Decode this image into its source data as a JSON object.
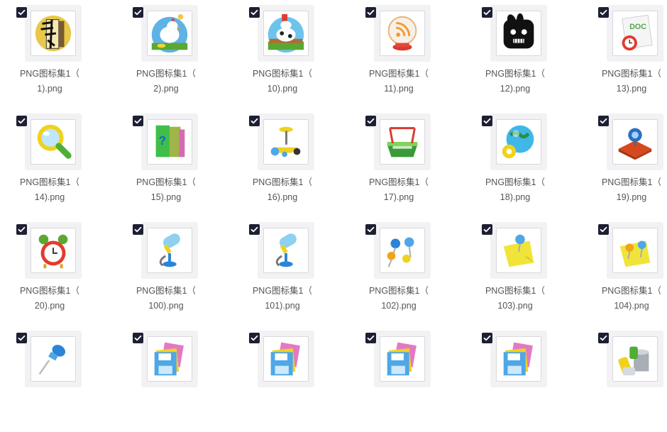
{
  "items": [
    {
      "line1": "PNG图标集1（",
      "line2": "1).png",
      "icon": "calligraphy-scroll-icon"
    },
    {
      "line1": "PNG图标集1（",
      "line2": "2).png",
      "icon": "chicken-icon"
    },
    {
      "line1": "PNG图标集1（",
      "line2": "10).png",
      "icon": "cow-farm-icon"
    },
    {
      "line1": "PNG图标集1（",
      "line2": "11).png",
      "icon": "rss-crystal-ball-icon"
    },
    {
      "line1": "PNG图标集1（",
      "line2": "12).png",
      "icon": "black-rabbit-icon"
    },
    {
      "line1": "PNG图标集1（",
      "line2": "13).png",
      "icon": "doc-alarm-icon"
    },
    {
      "line1": "PNG图标集1（",
      "line2": "14).png",
      "icon": "magnifier-icon"
    },
    {
      "line1": "PNG图标集1（",
      "line2": "15).png",
      "icon": "help-books-icon"
    },
    {
      "line1": "PNG图标集1（",
      "line2": "16).png",
      "icon": "scooter-icon"
    },
    {
      "line1": "PNG图标集1（",
      "line2": "17).png",
      "icon": "basket-icon"
    },
    {
      "line1": "PNG图标集1（",
      "line2": "18).png",
      "icon": "globe-gear-icon"
    },
    {
      "line1": "PNG图标集1（",
      "line2": "19).png",
      "icon": "webcam-icon"
    },
    {
      "line1": "PNG图标集1（",
      "line2": "20).png",
      "icon": "alarm-clock-icon"
    },
    {
      "line1": "PNG图标集1（",
      "line2": "100).png",
      "icon": "microphone-icon"
    },
    {
      "line1": "PNG图标集1（",
      "line2": "101).png",
      "icon": "microphone-icon"
    },
    {
      "line1": "PNG图标集1（",
      "line2": "102).png",
      "icon": "pushpins-icon"
    },
    {
      "line1": "PNG图标集1（",
      "line2": "103).png",
      "icon": "sticky-note-pin-icon"
    },
    {
      "line1": "PNG图标集1（",
      "line2": "104).png",
      "icon": "sticky-note-pins-icon"
    },
    {
      "line1": "",
      "line2": "",
      "icon": "pushpin-icon"
    },
    {
      "line1": "",
      "line2": "",
      "icon": "floppy-disks-icon"
    },
    {
      "line1": "",
      "line2": "",
      "icon": "floppy-disks-icon"
    },
    {
      "line1": "",
      "line2": "",
      "icon": "floppy-disks-icon"
    },
    {
      "line1": "",
      "line2": "",
      "icon": "floppy-disks-icon"
    },
    {
      "line1": "",
      "line2": "",
      "icon": "battery-bucket-icon"
    }
  ]
}
